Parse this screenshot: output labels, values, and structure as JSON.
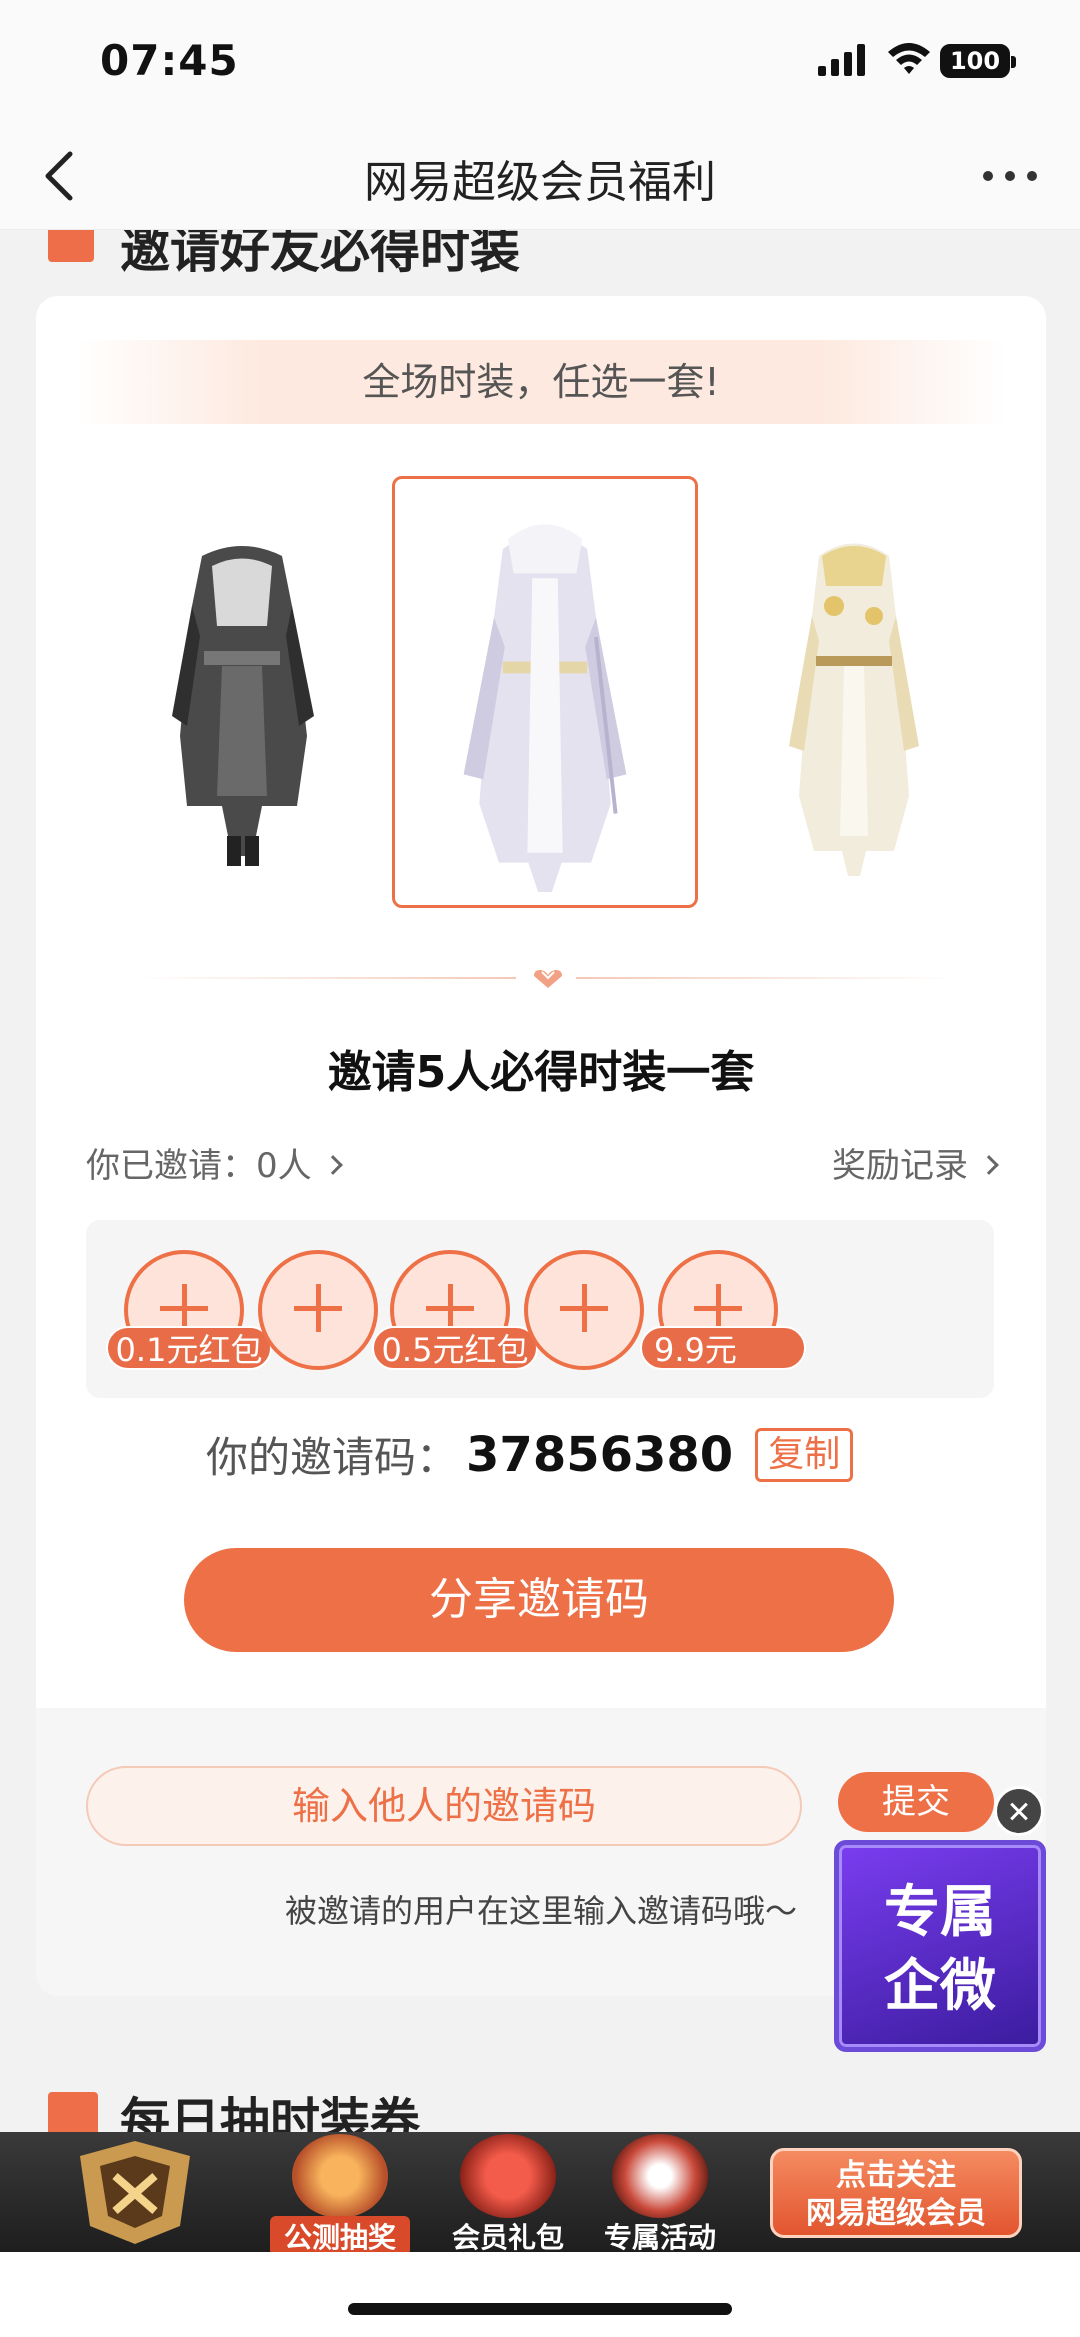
{
  "status": {
    "time": "07:45",
    "battery": "100"
  },
  "nav": {
    "title": "网易超级会员福利"
  },
  "section1": {
    "title": "邀请好友必得时装"
  },
  "banner": "全场时装，任选一套!",
  "invite": {
    "title": "邀请5人必得时装一套",
    "invited_label": "你已邀请：0人",
    "records_label": "奖励记录",
    "slots": [
      {
        "tag": "0.1元红包"
      },
      {
        "tag": ""
      },
      {
        "tag": "0.5元红包"
      },
      {
        "tag": ""
      },
      {
        "tag": "9.9元"
      }
    ],
    "code_label": "你的邀请码：",
    "code_value": "37856380",
    "copy_label": "复制",
    "share_label": "分享邀请码"
  },
  "enter_code": {
    "placeholder": "输入他人的邀请码",
    "submit_label": "提交",
    "hint": "被邀请的用户在这里输入邀请码哦～"
  },
  "widget": {
    "line1": "专属",
    "line2": "企微"
  },
  "section2": {
    "title": "每日抽时装券"
  },
  "tabbar": {
    "lottery": "公测抽奖",
    "gift": "会员礼包",
    "activity": "专属活动",
    "follow_line1": "点击关注",
    "follow_line2": "网易超级会员"
  },
  "colors": {
    "accent": "#ee7047",
    "accent_light": "#fde3d9"
  }
}
